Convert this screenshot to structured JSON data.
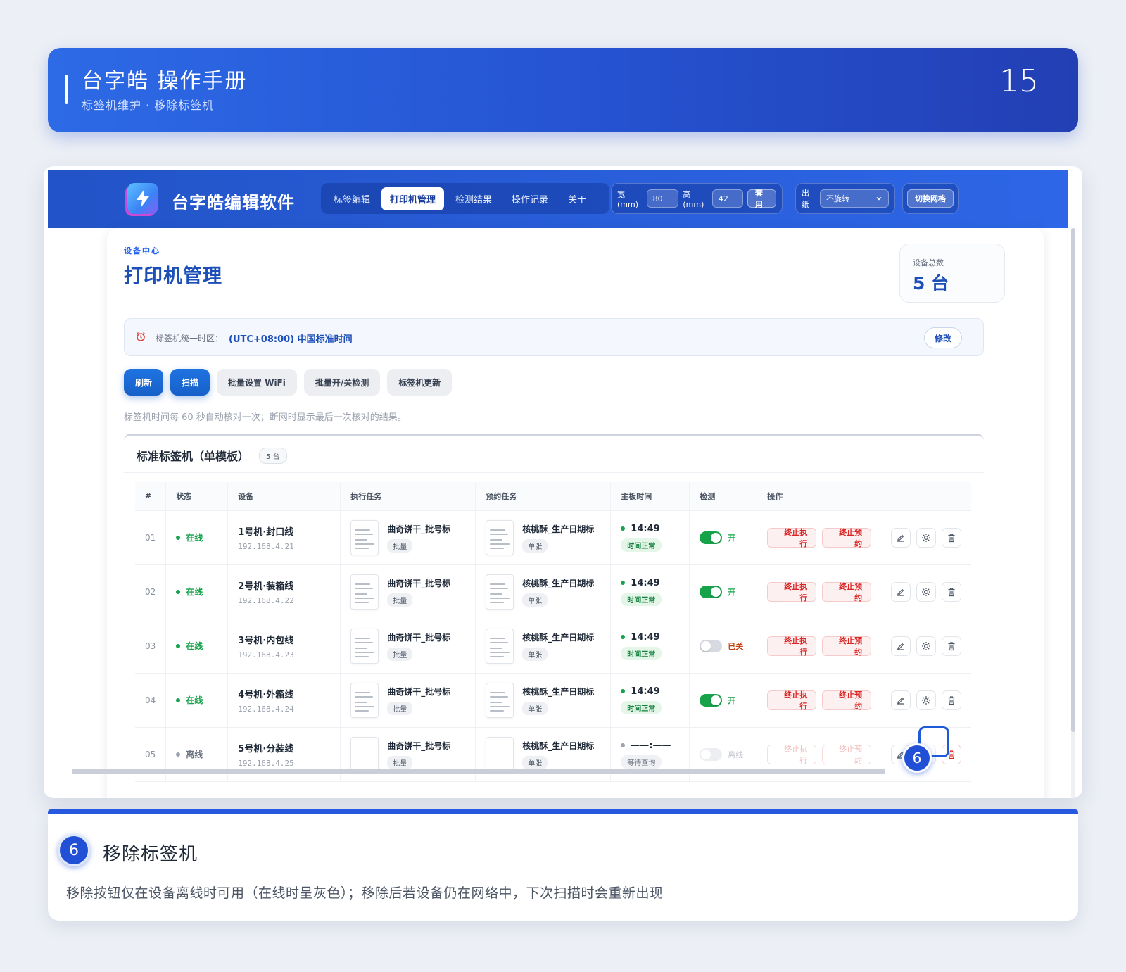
{
  "banner": {
    "title": "台字皓 操作手册",
    "subtitle": "标签机维护 · 移除标签机",
    "page_number": "15"
  },
  "app": {
    "name": "台字皓编辑软件",
    "tabs": [
      "标签编辑",
      "打印机管理",
      "检测结果",
      "操作记录",
      "关于"
    ],
    "active_tab": "打印机管理",
    "size": {
      "width_label": "宽(mm)",
      "width_value": "80",
      "height_label": "高(mm)",
      "height_value": "42",
      "apply_label": "套用"
    },
    "paper": {
      "label": "出纸",
      "rotation_value": "不旋转"
    },
    "grid_toggle_label": "切换网格"
  },
  "page": {
    "eyebrow": "设备中心",
    "title": "打印机管理",
    "stat": {
      "label": "设备总数",
      "value": "5 台"
    },
    "timezone": {
      "label": "标签机统一时区：",
      "value": "(UTC+08:00) 中国标准时间",
      "edit_label": "修改"
    },
    "actions": [
      {
        "label": "刷新",
        "style": "primary"
      },
      {
        "label": "扫描",
        "style": "primary"
      },
      {
        "label": "批量设置 WiFi",
        "style": "gray"
      },
      {
        "label": "批量开/关检测",
        "style": "gray"
      },
      {
        "label": "标签机更新",
        "style": "gray"
      }
    ],
    "hint": "标签机时间每 60 秒自动核对一次；断网时显示最后一次核对的结果。"
  },
  "section": {
    "title": "标准标签机（单模板）",
    "count": "5 台",
    "columns": [
      "#",
      "状态",
      "设备",
      "执行任务",
      "预约任务",
      "主板时间",
      "检测",
      "操作"
    ],
    "rows": [
      {
        "idx": "01",
        "status": "在线",
        "online": true,
        "name": "1号机·封口线",
        "ip": "192.168.4.21",
        "exec_task": "曲奇饼干_批号标",
        "exec_mode": "批量",
        "sched_task": "核桃酥_生产日期标",
        "sched_mode": "单张",
        "time": "14:49",
        "time_tag": "时间正常",
        "detect": "开",
        "detect_state": "on"
      },
      {
        "idx": "02",
        "status": "在线",
        "online": true,
        "name": "2号机·装箱线",
        "ip": "192.168.4.22",
        "exec_task": "曲奇饼干_批号标",
        "exec_mode": "批量",
        "sched_task": "核桃酥_生产日期标",
        "sched_mode": "单张",
        "time": "14:49",
        "time_tag": "时间正常",
        "detect": "开",
        "detect_state": "on"
      },
      {
        "idx": "03",
        "status": "在线",
        "online": true,
        "name": "3号机·内包线",
        "ip": "192.168.4.23",
        "exec_task": "曲奇饼干_批号标",
        "exec_mode": "批量",
        "sched_task": "核桃酥_生产日期标",
        "sched_mode": "单张",
        "time": "14:49",
        "time_tag": "时间正常",
        "detect": "已关",
        "detect_state": "off"
      },
      {
        "idx": "04",
        "status": "在线",
        "online": true,
        "name": "4号机·外箱线",
        "ip": "192.168.4.24",
        "exec_task": "曲奇饼干_批号标",
        "exec_mode": "批量",
        "sched_task": "核桃酥_生产日期标",
        "sched_mode": "单张",
        "time": "14:49",
        "time_tag": "时间正常",
        "detect": "开",
        "detect_state": "on"
      },
      {
        "idx": "05",
        "status": "离线",
        "online": false,
        "name": "5号机·分装线",
        "ip": "192.168.4.25",
        "exec_task": "曲奇饼干_批号标",
        "exec_mode": "批量",
        "sched_task": "核桃酥_生产日期标",
        "sched_mode": "单张",
        "time": "——:——",
        "time_tag": "等待查询",
        "detect": "离线",
        "detect_state": "disabled"
      }
    ],
    "stop_exec_label": "终止执行",
    "stop_sched_label": "终止预约"
  },
  "callout": {
    "number": "6"
  },
  "step": {
    "number": "6",
    "title": "移除标签机",
    "text": "移除按钮仅在设备离线时可用（在线时呈灰色）；移除后若设备仍在网络中，下次扫描时会重新出现"
  },
  "colors": {
    "brand_blue": "#2552d0",
    "online_green": "#16a34a",
    "danger_red": "#dc2626"
  }
}
